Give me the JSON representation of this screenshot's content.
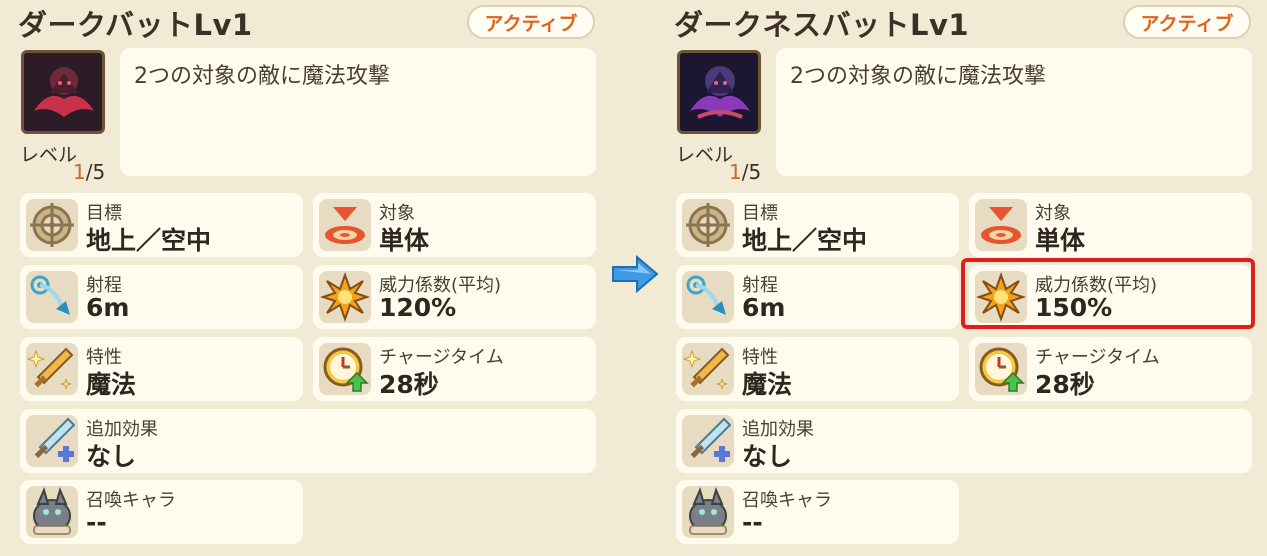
{
  "left": {
    "title": "ダークバットLv1",
    "badge": "アクティブ",
    "level_label": "レベル",
    "level_current": "1",
    "level_rest": "/5",
    "description": "2つの対象の敵に魔法攻撃",
    "stats": {
      "target": {
        "label": "目標",
        "value": "地上／空中",
        "icon": "crosshair-icon"
      },
      "scope": {
        "label": "対象",
        "value": "単体",
        "icon": "single-target-icon"
      },
      "range": {
        "label": "射程",
        "value": "6m",
        "icon": "range-arrow-icon"
      },
      "power": {
        "label": "威力係数(平均)",
        "value": "120%",
        "icon": "explosion-icon"
      },
      "trait": {
        "label": "特性",
        "value": "魔法",
        "icon": "sparkle-sword-icon"
      },
      "charge": {
        "label": "チャージタイム",
        "value": "28秒",
        "icon": "clock-up-icon"
      },
      "extra": {
        "label": "追加効果",
        "value": "なし",
        "icon": "sword-plus-icon"
      },
      "summon": {
        "label": "召喚キャラ",
        "value": "--",
        "icon": "summon-creature-icon"
      }
    }
  },
  "right": {
    "title": "ダークネスバットLv1",
    "badge": "アクティブ",
    "level_label": "レベル",
    "level_current": "1",
    "level_rest": "/5",
    "description": "2つの対象の敵に魔法攻撃",
    "stats": {
      "target": {
        "label": "目標",
        "value": "地上／空中",
        "icon": "crosshair-icon"
      },
      "scope": {
        "label": "対象",
        "value": "単体",
        "icon": "single-target-icon"
      },
      "range": {
        "label": "射程",
        "value": "6m",
        "icon": "range-arrow-icon"
      },
      "power": {
        "label": "威力係数(平均)",
        "value": "150%",
        "icon": "explosion-icon"
      },
      "trait": {
        "label": "特性",
        "value": "魔法",
        "icon": "sparkle-sword-icon"
      },
      "charge": {
        "label": "チャージタイム",
        "value": "28秒",
        "icon": "clock-up-icon"
      },
      "extra": {
        "label": "追加効果",
        "value": "なし",
        "icon": "sword-plus-icon"
      },
      "summon": {
        "label": "召喚キャラ",
        "value": "--",
        "icon": "summon-creature-icon"
      }
    }
  },
  "colors": {
    "background": "#f1ead5",
    "card": "#fffbee",
    "badge_text": "#e1611b",
    "highlight": "#e11d1d",
    "arrow": "#3d9be6"
  }
}
